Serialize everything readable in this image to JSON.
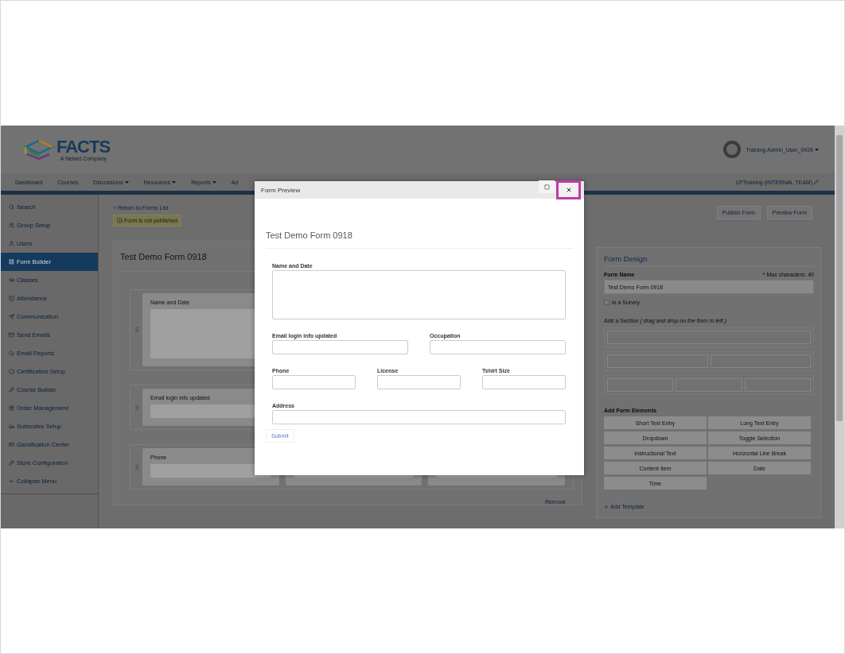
{
  "header": {
    "logo": {
      "wordmark": "FACTS",
      "tagline": "A Nelnet Company"
    },
    "user": "Training Admin_User_0424"
  },
  "nav": {
    "items": [
      {
        "label": "Dashboard",
        "dropdown": false
      },
      {
        "label": "Courses",
        "dropdown": false
      },
      {
        "label": "Discussions",
        "dropdown": true
      },
      {
        "label": "Resources",
        "dropdown": true
      },
      {
        "label": "Reports",
        "dropdown": true
      },
      {
        "label": "Ad",
        "dropdown": false
      }
    ],
    "school": "LPTraining (INTERNAL TEAM)"
  },
  "sidebar": {
    "items": [
      {
        "label": "Search",
        "selected": false
      },
      {
        "label": "Group Setup",
        "selected": false
      },
      {
        "label": "Users",
        "selected": false
      },
      {
        "label": "Form Builder",
        "selected": true
      },
      {
        "label": "Classes",
        "selected": false
      },
      {
        "label": "Attendance",
        "selected": false
      },
      {
        "label": "Communication",
        "selected": false
      },
      {
        "label": "Send Emails",
        "selected": false
      },
      {
        "label": "Email Reports",
        "selected": false
      },
      {
        "label": "Certification Setup",
        "selected": false
      },
      {
        "label": "Course Builder",
        "selected": false
      },
      {
        "label": "Order Management",
        "selected": false
      },
      {
        "label": "Subscales Setup",
        "selected": false
      },
      {
        "label": "Gamification Center",
        "selected": false
      },
      {
        "label": "Store Configuration",
        "selected": false
      },
      {
        "label": "Collapse Menu",
        "selected": false
      }
    ]
  },
  "builder": {
    "return_link": "Return to Forms List",
    "status_badge": "Form is not published",
    "title": "Test Demo Form 0918",
    "rows": [
      {
        "fields": [
          {
            "label": "Name and Date",
            "kind": "long"
          }
        ]
      },
      {
        "fields": [
          {
            "label": "Email login info updated",
            "kind": "short"
          }
        ]
      },
      {
        "fields": [
          {
            "label": "Phone",
            "kind": "short"
          },
          {
            "kind": "short"
          },
          {
            "kind": "short"
          }
        ]
      }
    ],
    "remove_link": "Remove"
  },
  "actions": [
    "Publish Form",
    "Preview Form"
  ],
  "form_design": {
    "title": "Form Design",
    "name_label": "Form Name",
    "max_note": "* Max characters: 40",
    "name_value": "Test Demo Form 0918",
    "survey": {
      "label": "Is a Survey",
      "checked": false
    },
    "section_label": "Add a Section *( drag and drop on the form to left )*",
    "elements_label": "Add Form Elements",
    "elements": [
      "Short Text Entry",
      "Long Text Entry",
      "Dropdown",
      "Toggle Selection",
      "Instructional Text",
      "Horizontal Line Break",
      "Content Item",
      "Date",
      "Time"
    ],
    "template_link": "Add Template"
  },
  "modal": {
    "title": "Form Preview",
    "form_title": "Test Demo Form 0918",
    "rows": [
      {
        "fields": [
          {
            "label": "Name and Date",
            "kind": "long"
          }
        ]
      },
      {
        "fields": [
          {
            "label": "Email login info updated",
            "kind": "short"
          },
          {
            "label": "Occupation",
            "kind": "short"
          }
        ]
      },
      {
        "fields": [
          {
            "label": "Phone",
            "kind": "short"
          },
          {
            "label": "License",
            "kind": "short"
          },
          {
            "label": "Tshirt Size",
            "kind": "short"
          }
        ]
      },
      {
        "fields": [
          {
            "label": "Address",
            "kind": "short"
          }
        ]
      }
    ],
    "submit": "Submit"
  }
}
